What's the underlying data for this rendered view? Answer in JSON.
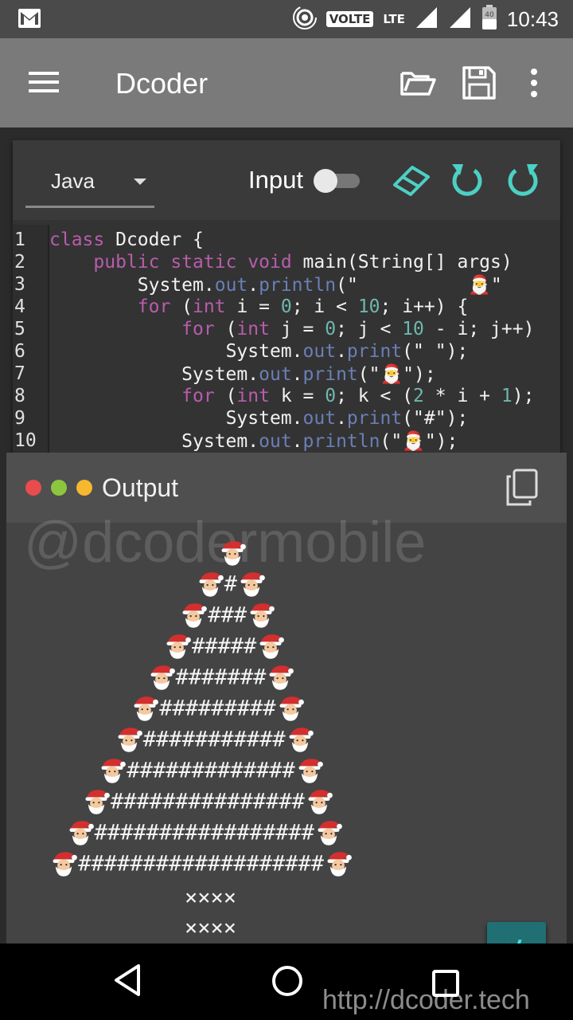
{
  "status_bar": {
    "volte": "VOLTE",
    "lte": "LTE",
    "battery": "40",
    "time": "10:43"
  },
  "app_bar": {
    "title": "Dcoder"
  },
  "editor": {
    "language": "Java",
    "input_label": "Input",
    "input_toggle_on": false,
    "line_numbers": [
      "1",
      "2",
      "3",
      "4",
      "5",
      "6",
      "7",
      "8",
      "9",
      "10"
    ]
  },
  "code_lines": [
    "class Dcoder {",
    "    public static void main(String[] args)",
    "        System.out.println(\"          🎅\"",
    "        for (int i = 0; i < 10; i++) {",
    "            for (int j = 0; j < 10 - i; j++)",
    "                System.out.print(\" \");",
    "            System.out.print(\"🎅\");",
    "            for (int k = 0; k < (2 * i + 1);",
    "                System.out.print(\"#\");",
    "            System.out.println(\"🎅\");"
  ],
  "output": {
    "title": "Output",
    "watermark": "@dcodermobile",
    "tree_rows": [
      "",
      "#",
      "###",
      "#####",
      "#######",
      "#########",
      "###########",
      "#############",
      "###############",
      "#################",
      "###################"
    ],
    "trunk_rows": [
      "××××",
      "××××"
    ]
  },
  "fab": {
    "label": "</>"
  },
  "footer_url": "http://dcoder.tech",
  "colors": {
    "accent": "#4dd0c4",
    "keyword": "#b85dab",
    "number": "#6fb7ad",
    "method": "#6a7fb6"
  }
}
